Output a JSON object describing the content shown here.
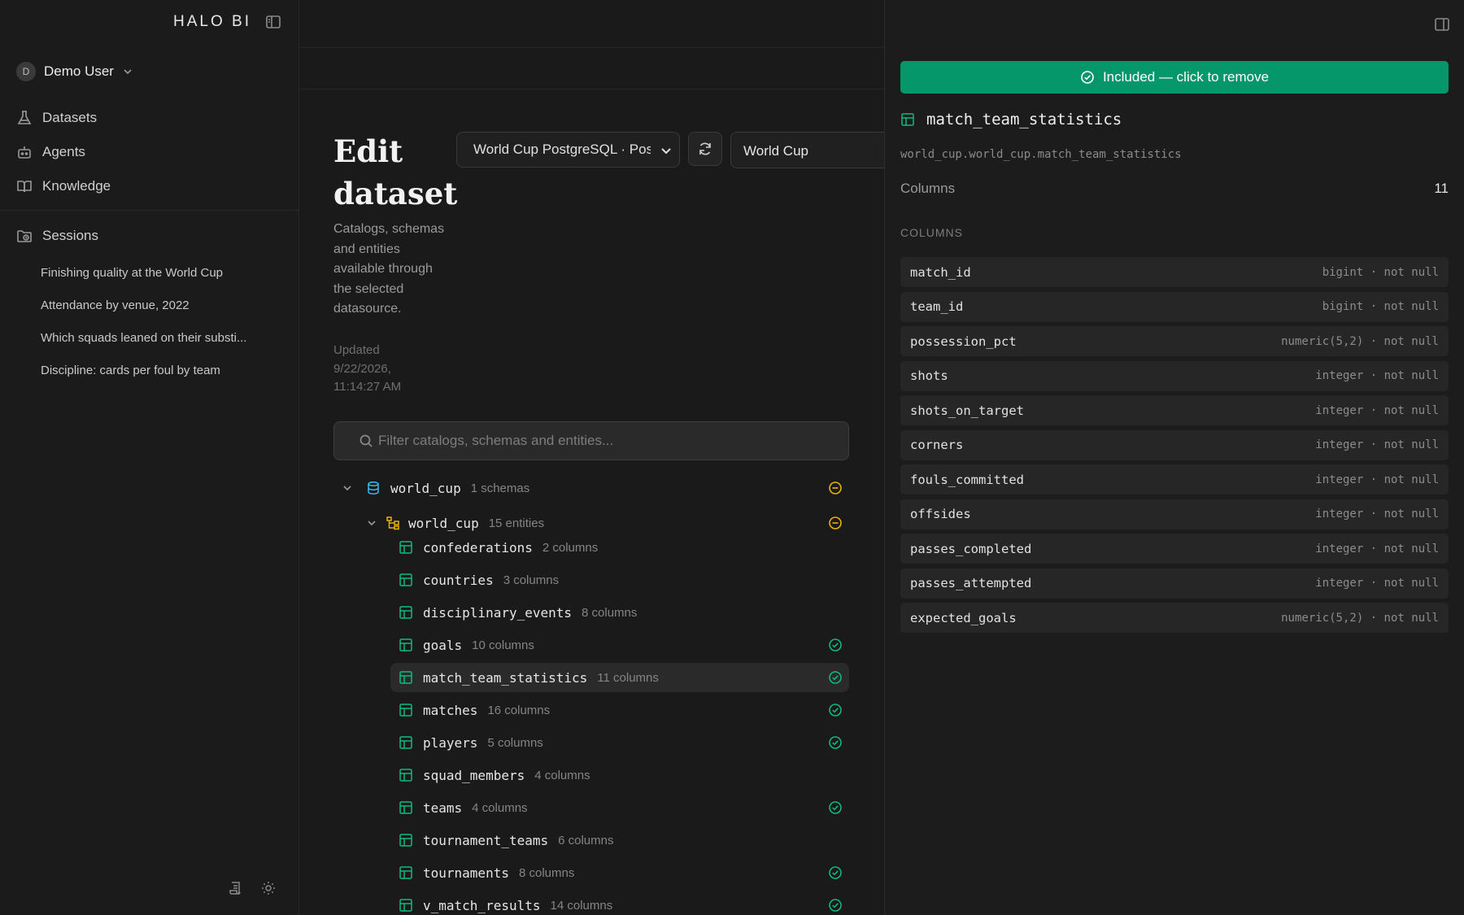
{
  "sidebar": {
    "brand": "HALO BI",
    "user": {
      "initial": "D",
      "name": "Demo User"
    },
    "nav": [
      {
        "label": "Datasets",
        "icon": "flask-icon"
      },
      {
        "label": "Agents",
        "icon": "robot-icon"
      },
      {
        "label": "Knowledge",
        "icon": "book-icon"
      }
    ],
    "sessions_label": "Sessions",
    "sessions": [
      "Finishing quality at the World Cup",
      "Attendance by venue, 2022",
      "Which squads leaned on their substi...",
      "Discipline: cards per foul by team"
    ]
  },
  "main": {
    "title": "Edit dataset",
    "description": "Catalogs, schemas and entities available through the selected datasource.",
    "updated": "Updated 9/22/2026, 11:14:27 AM",
    "datasource_select": "World Cup PostgreSQL · Post",
    "dataset_name": "World Cup",
    "filter_placeholder": "Filter catalogs, schemas and entities...",
    "tree": {
      "catalog": {
        "name": "world_cup",
        "meta": "1 schemas",
        "status": "partial"
      },
      "schema": {
        "name": "world_cup",
        "meta": "15 entities",
        "status": "partial"
      },
      "entities": [
        {
          "name": "confederations",
          "meta": "2 columns",
          "included": false
        },
        {
          "name": "countries",
          "meta": "3 columns",
          "included": false
        },
        {
          "name": "disciplinary_events",
          "meta": "8 columns",
          "included": false
        },
        {
          "name": "goals",
          "meta": "10 columns",
          "included": true
        },
        {
          "name": "match_team_statistics",
          "meta": "11 columns",
          "included": true,
          "selected": true
        },
        {
          "name": "matches",
          "meta": "16 columns",
          "included": true
        },
        {
          "name": "players",
          "meta": "5 columns",
          "included": true
        },
        {
          "name": "squad_members",
          "meta": "4 columns",
          "included": false
        },
        {
          "name": "teams",
          "meta": "4 columns",
          "included": true
        },
        {
          "name": "tournament_teams",
          "meta": "6 columns",
          "included": false
        },
        {
          "name": "tournaments",
          "meta": "8 columns",
          "included": true
        },
        {
          "name": "v_match_results",
          "meta": "14 columns",
          "included": true
        }
      ]
    }
  },
  "panel": {
    "include_button": "Included — click to remove",
    "entity_name": "match_team_statistics",
    "entity_path": "world_cup.world_cup.match_team_statistics",
    "columns_label": "Columns",
    "columns_count": "11",
    "columns_heading": "COLUMNS",
    "columns": [
      {
        "name": "match_id",
        "type": "bigint · not null"
      },
      {
        "name": "team_id",
        "type": "bigint · not null"
      },
      {
        "name": "possession_pct",
        "type": "numeric(5,2) · not null"
      },
      {
        "name": "shots",
        "type": "integer · not null"
      },
      {
        "name": "shots_on_target",
        "type": "integer · not null"
      },
      {
        "name": "corners",
        "type": "integer · not null"
      },
      {
        "name": "fouls_committed",
        "type": "integer · not null"
      },
      {
        "name": "offsides",
        "type": "integer · not null"
      },
      {
        "name": "passes_completed",
        "type": "integer · not null"
      },
      {
        "name": "passes_attempted",
        "type": "integer · not null"
      },
      {
        "name": "expected_goals",
        "type": "numeric(5,2) · not null"
      }
    ]
  },
  "colors": {
    "accent_green": "#059669",
    "status_green": "#10b981",
    "status_partial": "#eab308",
    "catalog_blue": "#38bdf8"
  }
}
